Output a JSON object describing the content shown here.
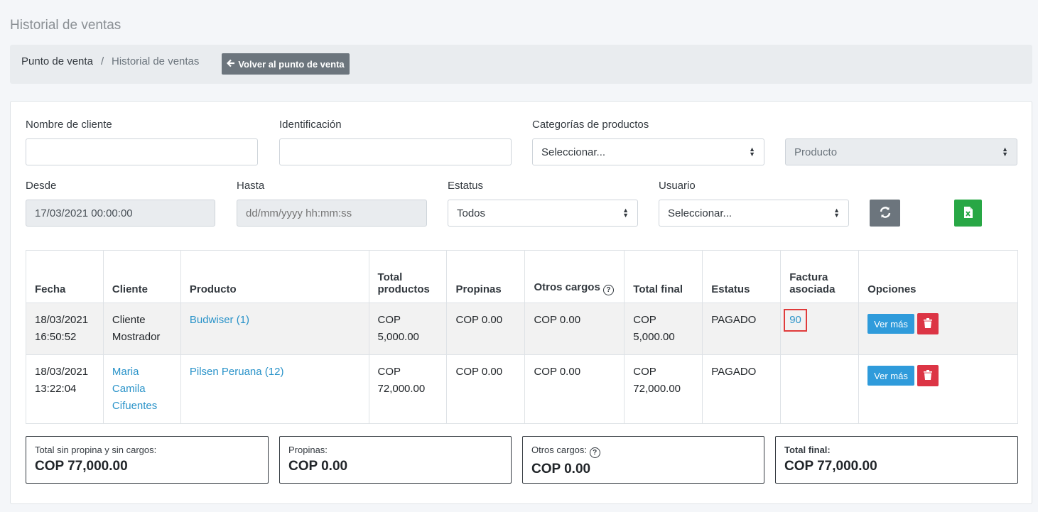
{
  "page": {
    "title": "Historial de ventas"
  },
  "breadcrumb": {
    "home": "Punto de venta",
    "separator": "/",
    "current": "Historial de ventas",
    "back_label": "Volver al punto de venta"
  },
  "filters": {
    "client_name": {
      "label": "Nombre de cliente",
      "value": ""
    },
    "identification": {
      "label": "Identificación",
      "value": ""
    },
    "categories": {
      "label": "Categorías de productos",
      "value": "Seleccionar..."
    },
    "product": {
      "value": "Producto"
    },
    "from": {
      "label": "Desde",
      "value": "17/03/2021 00:00:00"
    },
    "to": {
      "label": "Hasta",
      "placeholder": "dd/mm/yyyy hh:mm:ss"
    },
    "status": {
      "label": "Estatus",
      "value": "Todos"
    },
    "user": {
      "label": "Usuario",
      "value": "Seleccionar..."
    }
  },
  "table": {
    "headers": [
      "Fecha",
      "Cliente",
      "Producto",
      "Total productos",
      "Propinas",
      "Otros cargos",
      "Total final",
      "Estatus",
      "Factura asociada",
      "Opciones"
    ],
    "rows": [
      {
        "date": "18/03/2021 16:50:52",
        "client": "Cliente Mostrador",
        "product": "Budwiser (1)",
        "total_products": "COP 5,000.00",
        "tips": "COP 0.00",
        "other": "COP 0.00",
        "total": "COP 5,000.00",
        "status": "PAGADO",
        "invoice": "90",
        "view": "Ver más"
      },
      {
        "date": "18/03/2021 13:22:04",
        "client": "Maria Camila Cifuentes",
        "product": "Pilsen Peruana (12)",
        "total_products": "COP 72,000.00",
        "tips": "COP 0.00",
        "other": "COP 0.00",
        "total": "COP 72,000.00",
        "status": "PAGADO",
        "invoice": "",
        "view": "Ver más"
      }
    ]
  },
  "summary": {
    "subtotal": {
      "label": "Total sin propina y sin cargos:",
      "value": "COP 77,000.00"
    },
    "tips": {
      "label": "Propinas:",
      "value": "COP 0.00"
    },
    "other": {
      "label": "Otros cargos:",
      "value": "COP 0.00"
    },
    "total": {
      "label": "Total final:",
      "value": "COP 77,000.00"
    }
  },
  "colors": {
    "primary": "#2f9bdb",
    "danger": "#dc3545",
    "success": "#28a745",
    "secondary": "#6c757d",
    "link": "#2a93c9"
  },
  "icons": [
    "arrow-left-icon",
    "refresh-icon",
    "excel-icon",
    "trash-icon",
    "question-circle-icon",
    "select-arrows-icon"
  ]
}
